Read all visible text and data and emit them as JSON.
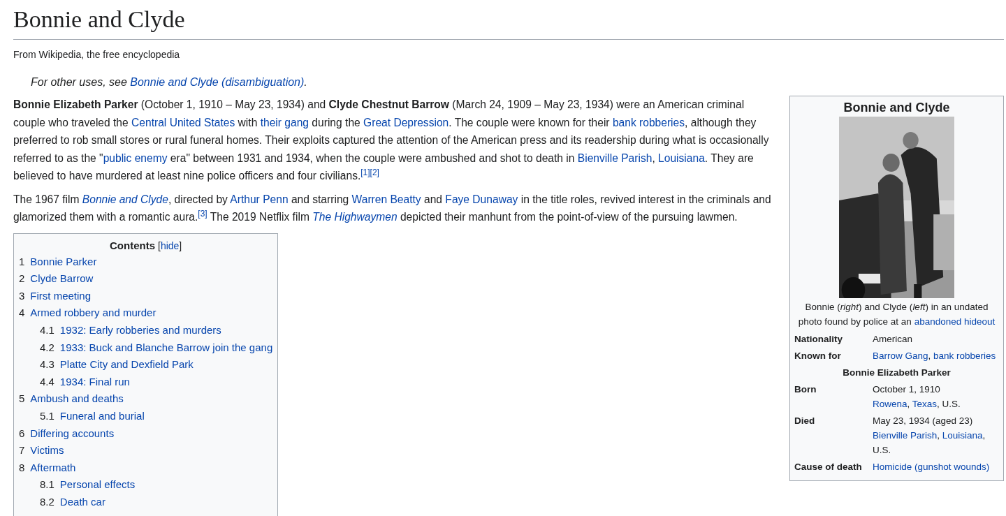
{
  "title": "Bonnie and Clyde",
  "tagline": "From Wikipedia, the free encyclopedia",
  "hatnote": [
    {
      "kind": "text",
      "text": "For other uses, see "
    },
    {
      "kind": "link",
      "text": "Bonnie and Clyde (disambiguation)"
    },
    {
      "kind": "text",
      "text": "."
    }
  ],
  "paragraphs": [
    [
      {
        "kind": "bold",
        "text": "Bonnie Elizabeth Parker"
      },
      {
        "kind": "text",
        "text": " (October 1, 1910 – May 23, 1934) and "
      },
      {
        "kind": "bold",
        "text": "Clyde Chestnut Barrow"
      },
      {
        "kind": "text",
        "text": " (March 24, 1909 – May 23, 1934) were an American criminal couple who traveled the "
      },
      {
        "kind": "link",
        "text": "Central United States"
      },
      {
        "kind": "text",
        "text": " with "
      },
      {
        "kind": "link",
        "text": "their gang"
      },
      {
        "kind": "text",
        "text": " during the "
      },
      {
        "kind": "link",
        "text": "Great Depression"
      },
      {
        "kind": "text",
        "text": ". The couple were known for their "
      },
      {
        "kind": "link",
        "text": "bank robberies"
      },
      {
        "kind": "text",
        "text": ", although they preferred to rob small stores or rural funeral homes. Their exploits captured the attention of the American press and its readership during what is occasionally referred to as the \""
      },
      {
        "kind": "link",
        "text": "public enemy"
      },
      {
        "kind": "text",
        "text": " era\" between 1931 and 1934, when the couple were ambushed and shot to death in "
      },
      {
        "kind": "link",
        "text": "Bienville Parish"
      },
      {
        "kind": "text",
        "text": ", "
      },
      {
        "kind": "link",
        "text": "Louisiana"
      },
      {
        "kind": "text",
        "text": ". They are believed to have murdered at least nine police officers and four civilians."
      },
      {
        "kind": "ref",
        "text": "[1]"
      },
      {
        "kind": "ref",
        "text": "[2]"
      }
    ],
    [
      {
        "kind": "text",
        "text": "The 1967 film "
      },
      {
        "kind": "ilink",
        "text": "Bonnie and Clyde"
      },
      {
        "kind": "text",
        "text": ", directed by "
      },
      {
        "kind": "link",
        "text": "Arthur Penn"
      },
      {
        "kind": "text",
        "text": " and starring "
      },
      {
        "kind": "link",
        "text": "Warren Beatty"
      },
      {
        "kind": "text",
        "text": " and "
      },
      {
        "kind": "link",
        "text": "Faye Dunaway"
      },
      {
        "kind": "text",
        "text": " in the title roles, revived interest in the criminals and glamorized them with a romantic aura."
      },
      {
        "kind": "ref",
        "text": "[3]"
      },
      {
        "kind": "text",
        "text": " The 2019 Netflix film "
      },
      {
        "kind": "ilink",
        "text": "The Highwaymen"
      },
      {
        "kind": "text",
        "text": " depicted their manhunt from the point-of-view of the pursuing lawmen."
      }
    ]
  ],
  "toc": {
    "title": "Contents",
    "toggle": {
      "open": "[",
      "label": "hide",
      "close": "]"
    },
    "items": [
      {
        "number": "1",
        "label": "Bonnie Parker"
      },
      {
        "number": "2",
        "label": "Clyde Barrow"
      },
      {
        "number": "3",
        "label": "First meeting"
      },
      {
        "number": "4",
        "label": "Armed robbery and murder",
        "children": [
          {
            "number": "4.1",
            "label": "1932: Early robberies and murders"
          },
          {
            "number": "4.2",
            "label": "1933: Buck and Blanche Barrow join the gang"
          },
          {
            "number": "4.3",
            "label": "Platte City and Dexfield Park"
          },
          {
            "number": "4.4",
            "label": "1934: Final run"
          }
        ]
      },
      {
        "number": "5",
        "label": "Ambush and deaths",
        "children": [
          {
            "number": "5.1",
            "label": "Funeral and burial"
          }
        ]
      },
      {
        "number": "6",
        "label": "Differing accounts"
      },
      {
        "number": "7",
        "label": "Victims"
      },
      {
        "number": "8",
        "label": "Aftermath",
        "children": [
          {
            "number": "8.1",
            "label": "Personal effects"
          },
          {
            "number": "8.2",
            "label": "Death car"
          }
        ]
      }
    ]
  },
  "infobox": {
    "title": "Bonnie and Clyde",
    "caption": [
      {
        "kind": "text",
        "text": "Bonnie ("
      },
      {
        "kind": "italic",
        "text": "right"
      },
      {
        "kind": "text",
        "text": ") and Clyde ("
      },
      {
        "kind": "italic",
        "text": "left"
      },
      {
        "kind": "text",
        "text": ") in an undated photo found by police at an "
      },
      {
        "kind": "link",
        "text": "abandoned hideout"
      }
    ],
    "rows": [
      {
        "kind": "field",
        "label": "Nationality",
        "value": [
          [
            {
              "kind": "text",
              "text": "American"
            }
          ]
        ]
      },
      {
        "kind": "field",
        "label": "Known for",
        "value": [
          [
            {
              "kind": "link",
              "text": "Barrow Gang"
            },
            {
              "kind": "text",
              "text": ", "
            },
            {
              "kind": "link",
              "text": "bank robberies"
            }
          ]
        ]
      },
      {
        "kind": "header",
        "label": "Bonnie Elizabeth Parker"
      },
      {
        "kind": "field",
        "label": "Born",
        "value": [
          [
            {
              "kind": "text",
              "text": "October 1, 1910"
            }
          ],
          [
            {
              "kind": "link",
              "text": "Rowena"
            },
            {
              "kind": "text",
              "text": ", "
            },
            {
              "kind": "link",
              "text": "Texas"
            },
            {
              "kind": "text",
              "text": ", U.S."
            }
          ]
        ]
      },
      {
        "kind": "field",
        "label": "Died",
        "value": [
          [
            {
              "kind": "text",
              "text": "May 23, 1934 (aged 23)"
            }
          ],
          [
            {
              "kind": "link",
              "text": "Bienville Parish"
            },
            {
              "kind": "text",
              "text": ", "
            },
            {
              "kind": "link",
              "text": "Louisiana"
            },
            {
              "kind": "text",
              "text": ", U.S."
            }
          ]
        ]
      },
      {
        "kind": "field",
        "label": "Cause of death",
        "value": [
          [
            {
              "kind": "link",
              "text": "Homicide (gunshot wounds)"
            }
          ]
        ]
      }
    ]
  }
}
